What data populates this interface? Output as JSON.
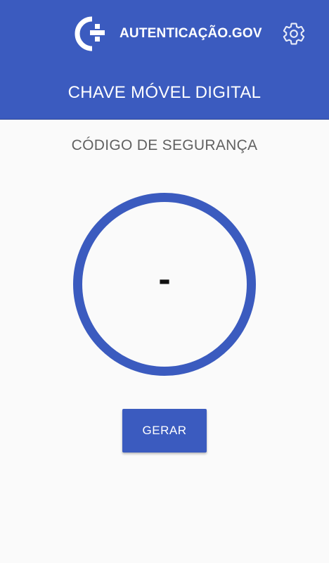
{
  "header": {
    "brand_name": "AUTENTICAÇÃO.GOV",
    "logo_icon": "autenticacao-gov-logo",
    "settings_icon": "gear-icon",
    "app_title": "CHAVE MÓVEL DIGITAL"
  },
  "main": {
    "section_title": "CÓDIGO DE SEGURANÇA",
    "code_value": "-",
    "generate_label": "GERAR"
  },
  "colors": {
    "primary": "#3b5bbf",
    "background": "#fafafa",
    "text_secondary": "#616161",
    "code_text": "#111111"
  }
}
